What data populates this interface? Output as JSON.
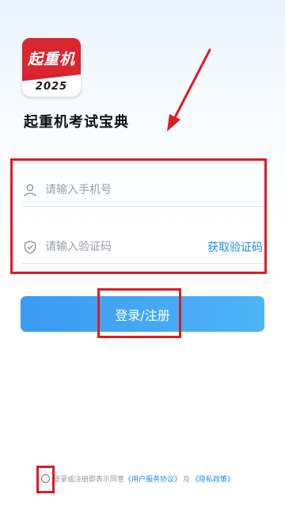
{
  "app": {
    "logo_text": "起重机",
    "logo_year": "2025",
    "name": "起重机考试宝典"
  },
  "form": {
    "phone_placeholder": "请输入手机号",
    "code_placeholder": "请输入验证码",
    "get_code_label": "获取验证码",
    "submit_label": "登录/注册"
  },
  "agreement": {
    "prefix": "登录或注册即表示同意",
    "terms_link": "《用户服务协议》",
    "connector": "及",
    "privacy_link": "《隐私政策》"
  },
  "icons": {
    "phone_field": "user-icon",
    "code_field": "shield-check-icon"
  },
  "colors": {
    "accent": "#1f8ee8",
    "button_gradient_start": "#3a9bf2",
    "button_gradient_end": "#4eb4f6",
    "annotation_red": "#e01a22",
    "logo_red": "#d9262f"
  }
}
